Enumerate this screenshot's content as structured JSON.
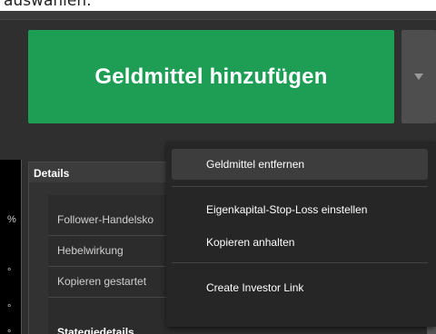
{
  "caption": "auswählen.",
  "main_button": {
    "label": "Geldmittel hinzufügen"
  },
  "dropdown": {
    "caret_icon": "caret-down-icon"
  },
  "left_panel": {
    "ticks": [
      "%",
      "°",
      "°",
      "°"
    ]
  },
  "details": {
    "title": "Details",
    "rows": [
      {
        "label": "Follower-Handelsko"
      },
      {
        "label": "Hebelwirkung"
      },
      {
        "label": "Kopieren gestartet"
      }
    ],
    "strategy_title": "Stategiedetails"
  },
  "menu": {
    "items": [
      {
        "label": "Geldmittel entfernen"
      },
      {
        "label": "Eigenkapital-Stop-Loss einstellen"
      },
      {
        "label": "Kopieren anhalten"
      },
      {
        "label": "Create Investor Link"
      }
    ]
  },
  "colors": {
    "accent_green": "#1e9d55",
    "panel_dark": "#2f2f2f",
    "menu_bg": "#262626"
  }
}
